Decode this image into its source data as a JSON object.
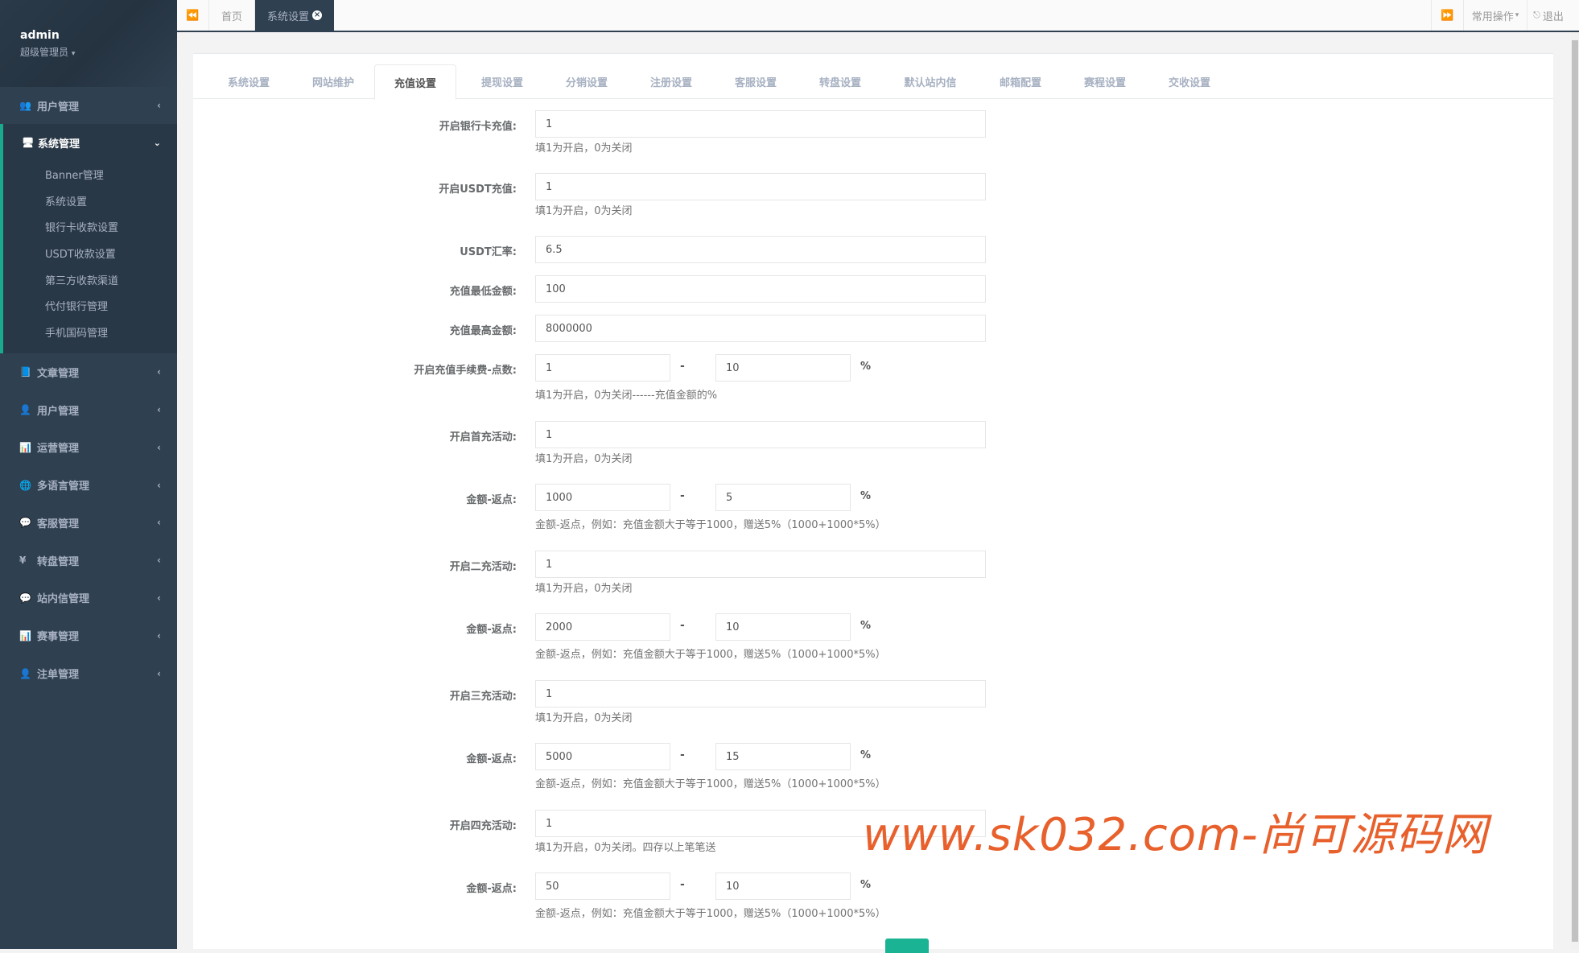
{
  "user": {
    "name": "admin",
    "role": "超级管理员"
  },
  "sidebar": {
    "items_before": [
      {
        "label": "用户管理",
        "icon": "users-icon"
      }
    ],
    "active": {
      "label": "系统管理",
      "icon": "desktop-icon",
      "subs": [
        "Banner管理",
        "系统设置",
        "银行卡收款设置",
        "USDT收款设置",
        "第三方收款渠道",
        "代付银行管理",
        "手机国码管理"
      ]
    },
    "items_after": [
      {
        "label": "文章管理",
        "icon": "book-icon"
      },
      {
        "label": "用户管理",
        "icon": "user-icon"
      },
      {
        "label": "运营管理",
        "icon": "bar-chart-icon"
      },
      {
        "label": "多语言管理",
        "icon": "globe-icon"
      },
      {
        "label": "客服管理",
        "icon": "comment-icon"
      },
      {
        "label": "转盘管理",
        "icon": "yen-icon"
      },
      {
        "label": "站内信管理",
        "icon": "comment-icon"
      },
      {
        "label": "赛事管理",
        "icon": "bar-chart-icon"
      },
      {
        "label": "注单管理",
        "icon": "user-icon"
      }
    ]
  },
  "topbar": {
    "tabs": [
      "首页",
      "系统设置"
    ],
    "common_ops": "常用操作",
    "logout": "退出"
  },
  "settings_tabs": [
    "系统设置",
    "网站维护",
    "充值设置",
    "提现设置",
    "分销设置",
    "注册设置",
    "客服设置",
    "转盘设置",
    "默认站内信",
    "邮箱配置",
    "赛程设置",
    "交收设置"
  ],
  "active_tab": "充值设置",
  "form": {
    "bank_card": {
      "label": "开启银行卡充值:",
      "value": "1",
      "help": "填1为开启，0为关闭"
    },
    "usdt": {
      "label": "开启USDT充值:",
      "value": "1",
      "help": "填1为开启，0为关闭"
    },
    "usdt_rate": {
      "label": "USDT汇率:",
      "value": "6.5"
    },
    "min_amount": {
      "label": "充值最低金额:",
      "value": "100"
    },
    "max_amount": {
      "label": "充值最高金额:",
      "value": "8000000"
    },
    "fee": {
      "label": "开启充值手续费-点数:",
      "value1": "1",
      "value2": "10",
      "unit": "%",
      "sep": "-",
      "help": "填1为开启，0为关闭------充值金额的%"
    },
    "first": {
      "label": "开启首充活动:",
      "value": "1",
      "help": "填1为开启，0为关闭"
    },
    "first_rebate": {
      "label": "金额-返点:",
      "value1": "1000",
      "value2": "5",
      "unit": "%",
      "sep": "-",
      "help": "金额-返点，例如：充值金额大于等于1000，赠送5%（1000+1000*5%）"
    },
    "second": {
      "label": "开启二充活动:",
      "value": "1",
      "help": "填1为开启，0为关闭"
    },
    "second_rebate": {
      "label": "金额-返点:",
      "value1": "2000",
      "value2": "10",
      "unit": "%",
      "sep": "-",
      "help": "金额-返点，例如：充值金额大于等于1000，赠送5%（1000+1000*5%）"
    },
    "third": {
      "label": "开启三充活动:",
      "value": "1",
      "help": "填1为开启，0为关闭"
    },
    "third_rebate": {
      "label": "金额-返点:",
      "value1": "5000",
      "value2": "15",
      "unit": "%",
      "sep": "-",
      "help": "金额-返点，例如：充值金额大于等于1000，赠送5%（1000+1000*5%）"
    },
    "fourth": {
      "label": "开启四充活动:",
      "value": "1",
      "help": "填1为开启，0为关闭。四存以上笔笔送"
    },
    "fourth_rebate": {
      "label": "金额-返点:",
      "value1": "50",
      "value2": "10",
      "unit": "%",
      "sep": "-",
      "help": "金额-返点，例如：充值金额大于等于1000，赠送5%（1000+1000*5%）"
    }
  },
  "watermark": "www.sk032.com-尚可源码网",
  "colors": {
    "sidebar": "#2f4050",
    "accent": "#19aa8d",
    "button": "#1ab394"
  }
}
